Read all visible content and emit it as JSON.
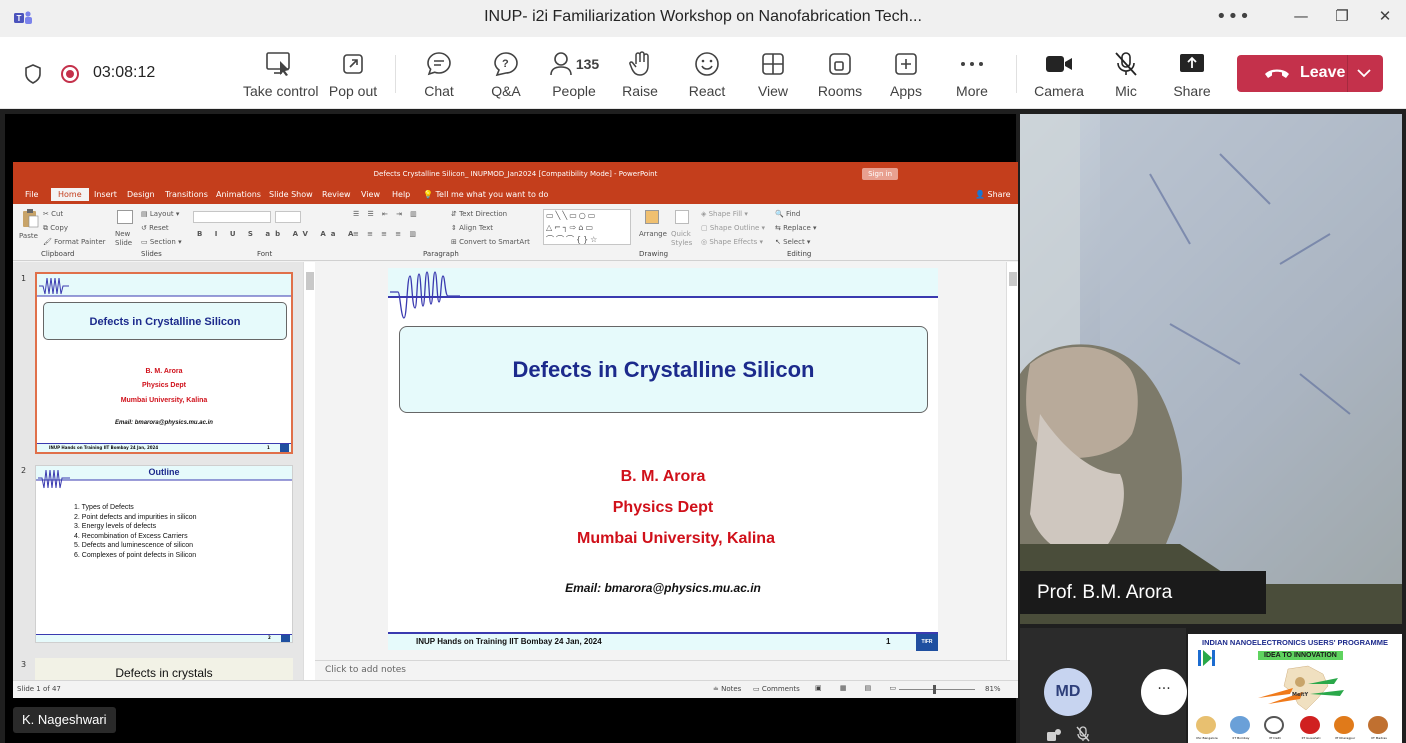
{
  "window": {
    "title": "INUP- i2i Familiarization Workshop on Nanofabrication Tech...",
    "more": "•••",
    "minimize": "—",
    "maximize": "❐",
    "close": "✕"
  },
  "toolbar": {
    "timer": "03:08:12",
    "people_count": "135",
    "buttons": [
      {
        "label": "Take control",
        "icon": "take-control-icon"
      },
      {
        "label": "Pop out",
        "icon": "pop-out-icon"
      },
      {
        "label": "Chat",
        "icon": "chat-icon"
      },
      {
        "label": "Q&A",
        "icon": "qa-icon"
      },
      {
        "label": "People",
        "icon": "people-icon"
      },
      {
        "label": "Raise",
        "icon": "hand-icon"
      },
      {
        "label": "React",
        "icon": "smiley-icon"
      },
      {
        "label": "View",
        "icon": "grid-icon"
      },
      {
        "label": "Rooms",
        "icon": "rooms-icon"
      },
      {
        "label": "Apps",
        "icon": "plus-icon"
      },
      {
        "label": "More",
        "icon": "more-icon"
      },
      {
        "label": "Camera",
        "icon": "camera-icon"
      },
      {
        "label": "Mic",
        "icon": "mic-muted-icon"
      },
      {
        "label": "Share",
        "icon": "share-icon"
      }
    ],
    "leave_label": "Leave",
    "accent": "#c4314b"
  },
  "ppt": {
    "title": "Defects Crystalline Silicon_ INUPMOD_Jan2024 [Compatibility Mode] - PowerPoint",
    "sign_in": "Sign in",
    "tabs": [
      "File",
      "Home",
      "Insert",
      "Design",
      "Transitions",
      "Animations",
      "Slide Show",
      "Review",
      "View",
      "Help"
    ],
    "tell_me": "Tell me what you want to do",
    "share": "Share",
    "ribbon": {
      "paste": "Paste",
      "cut": "Cut",
      "copy": "Copy",
      "format_painter": "Format Painter",
      "clipboard": "Clipboard",
      "new_slide": "New Slide",
      "layout": "Layout",
      "reset": "Reset",
      "section": "Section",
      "slides": "Slides",
      "font": "Font",
      "paragraph": "Paragraph",
      "text_direction": "Text Direction",
      "align_text": "Align Text",
      "convert_smartart": "Convert to SmartArt",
      "arrange": "Arrange",
      "quick_styles": "Quick Styles",
      "shape_fill": "Shape Fill",
      "shape_outline": "Shape Outline",
      "shape_effects": "Shape Effects",
      "drawing": "Drawing",
      "find": "Find",
      "replace": "Replace",
      "select": "Select",
      "editing": "Editing"
    },
    "thumbnails": [
      {
        "num": "1",
        "title": "Defects in Crystalline Silicon",
        "author": "B. M. Arora",
        "dept": "Physics Dept",
        "univ": "Mumbai University, Kalina",
        "email": "Email: bmarora@physics.mu.ac.in",
        "footer": "INUP Hands on Training IIT Bombay 24 Jan, 2024",
        "page": "1"
      },
      {
        "num": "2",
        "title": "Outline",
        "items": [
          "1.  Types of Defects",
          "2.  Point defects and impurities in silicon",
          "3.  Energy levels of defects",
          "4.  Recombination of Excess Carriers",
          "5.  Defects and  luminescence of silicon",
          "6.  Complexes of point defects in Silicon"
        ],
        "page": "2"
      },
      {
        "num": "3",
        "title": "Defects in crystals"
      }
    ],
    "slide": {
      "title": "Defects in Crystalline Silicon",
      "author": "B. M. Arora",
      "dept": "Physics Dept",
      "univ": "Mumbai University, Kalina",
      "email": "Email: bmarora@physics.mu.ac.in",
      "footer": "INUP Hands on Training IIT Bombay 24 Jan, 2024",
      "page": "1",
      "logo": "TIFR"
    },
    "notes_placeholder": "Click to add notes",
    "status": {
      "slide_count": "Slide 1 of 47",
      "notes": "Notes",
      "comments": "Comments",
      "zoom": "81%"
    }
  },
  "presenter_tag": "K. Nageshwari",
  "video": {
    "name": "Prof. B.M. Arora"
  },
  "participant": {
    "initials": "MD",
    "more": "···"
  },
  "logo": {
    "title": "INDIAN NANOELECTRONICS USERS' PROGRAMME",
    "tagline": "IDEA TO INNOVATION",
    "meity": "MeitY",
    "institutes": [
      "IISc Bangalore",
      "IIT Bombay",
      "IIT Delhi",
      "IIT Guwahati",
      "IIT Kharagpur",
      "IIT Madras"
    ]
  }
}
